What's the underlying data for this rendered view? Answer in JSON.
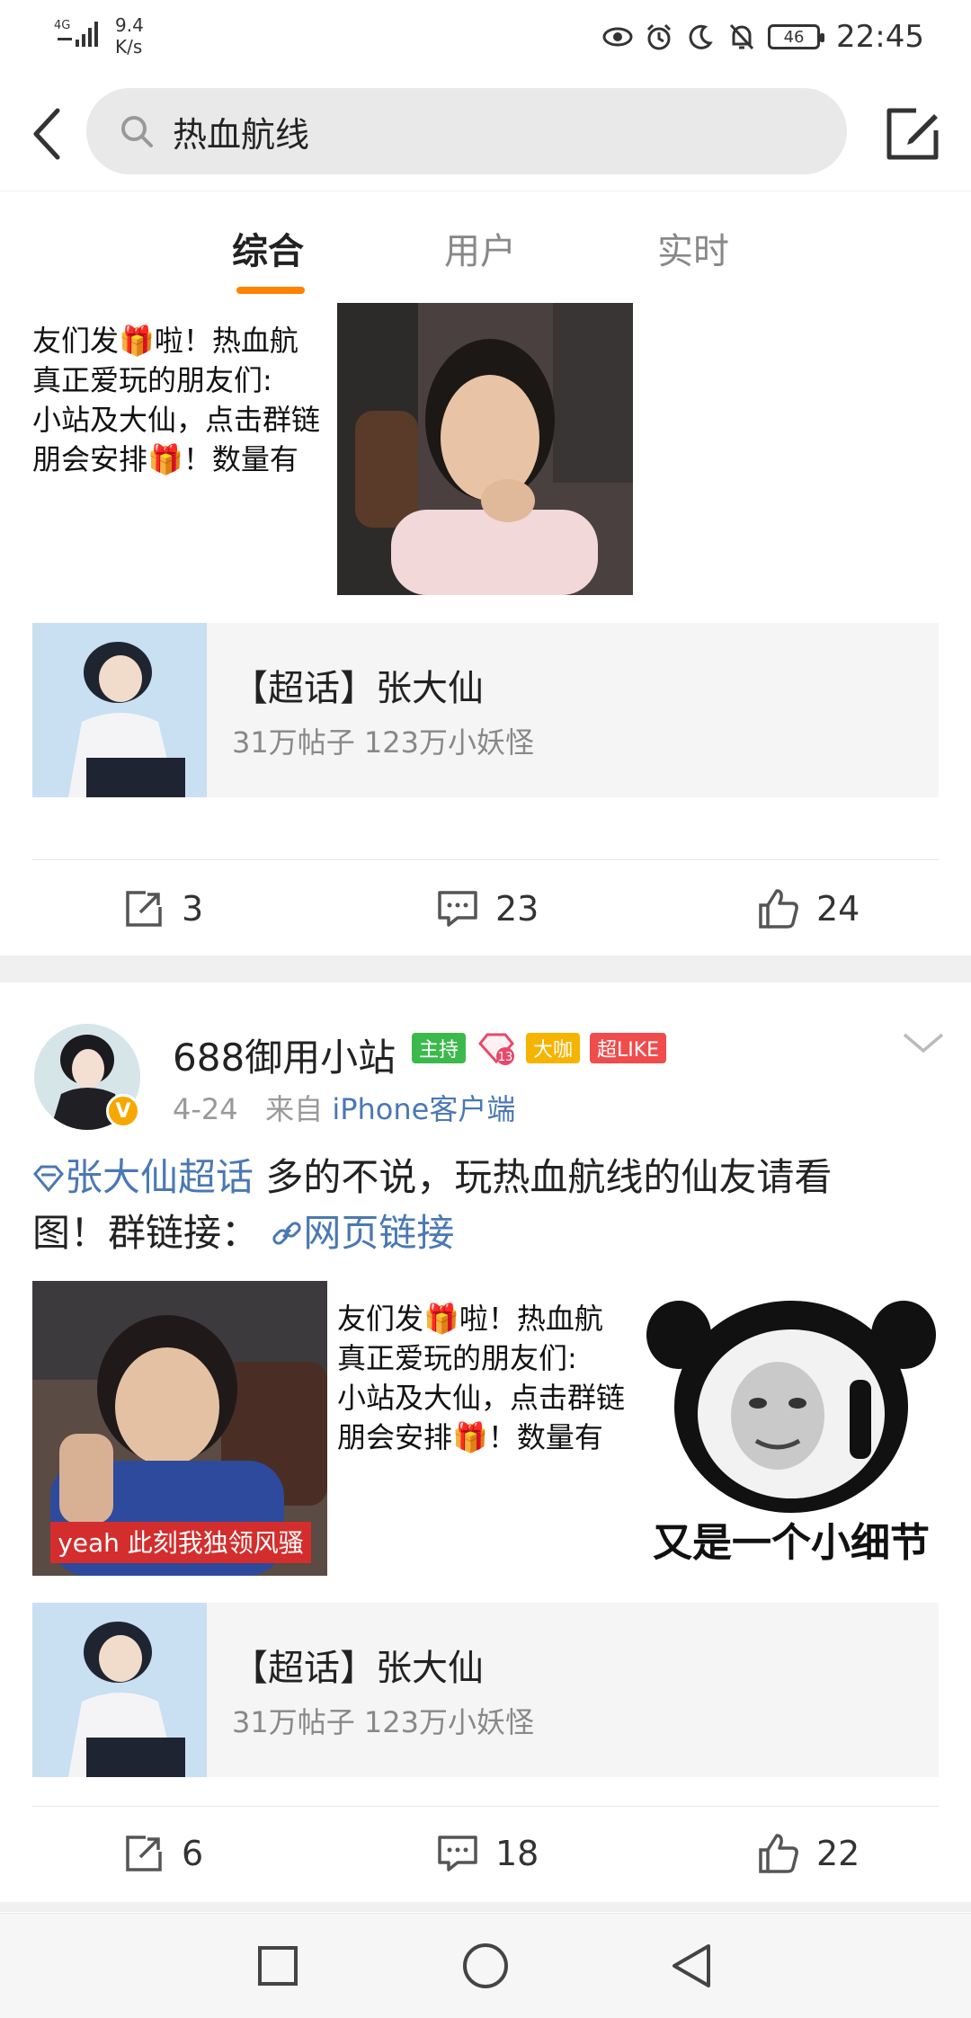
{
  "status_bar": {
    "network": "4G",
    "speed_value": "9.4",
    "speed_unit": "K/s",
    "battery": "46",
    "time": "22:45"
  },
  "search": {
    "query": "热血航线"
  },
  "tabs": [
    {
      "label": "综合",
      "active": true
    },
    {
      "label": "用户",
      "active": false
    },
    {
      "label": "实时",
      "active": false
    }
  ],
  "post1": {
    "image_text_lines": [
      "友们发🎁啦！热血航",
      "  真正爱玩的朋友们:",
      "小站及大仙，点击群链",
      "朋会安排🎁！数量有"
    ],
    "topic": {
      "title": "【超话】张大仙",
      "meta": "31万帖子 123万小妖怪"
    },
    "actions": {
      "repost": "3",
      "comment": "23",
      "like": "24"
    }
  },
  "post2": {
    "user": {
      "name": "688御用小站",
      "badges": [
        "主持",
        "13",
        "大咖",
        "超LIKE"
      ],
      "verified_mark": "V"
    },
    "meta": {
      "date": "4-24",
      "from_label": "来自",
      "source": "iPhone客户端"
    },
    "text": {
      "topic_link": "张大仙超话",
      "body_1": " 多的不说，玩热血航线的仙友请看",
      "body_2": "图！群链接： ",
      "web_link": "网页链接"
    },
    "image1_caption": "yeah 此刻我独领风骚",
    "image2_text_lines": [
      "友们发🎁啦！热血航",
      "  真正爱玩的朋友们:",
      "小站及大仙，点击群链",
      "朋会安排🎁！数量有"
    ],
    "image3_caption": "又是一个小细节",
    "topic": {
      "title": "【超话】张大仙",
      "meta": "31万帖子 123万小妖怪"
    },
    "actions": {
      "repost": "6",
      "comment": "18",
      "like": "22"
    }
  },
  "colors": {
    "accent": "#ff8200",
    "link": "#4a78b5"
  }
}
